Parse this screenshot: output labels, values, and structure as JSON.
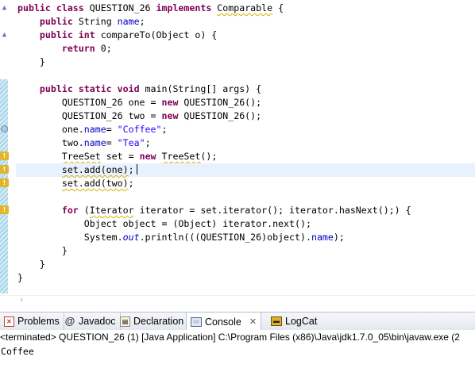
{
  "code_lines": [
    {
      "tokens": [
        {
          "t": "public class ",
          "c": "kw"
        },
        {
          "t": "QUESTION_26 "
        },
        {
          "t": "implements ",
          "c": "kw"
        },
        {
          "t": "Comparable",
          "c": "warnu"
        },
        {
          "t": " {"
        }
      ]
    },
    {
      "tokens": [
        {
          "t": "    "
        },
        {
          "t": "public ",
          "c": "kw"
        },
        {
          "t": "String "
        },
        {
          "t": "name",
          "c": "fld"
        },
        {
          "t": ";"
        }
      ]
    },
    {
      "tokens": [
        {
          "t": "    "
        },
        {
          "t": "public int ",
          "c": "kw"
        },
        {
          "t": "compareTo(Object o) {"
        }
      ]
    },
    {
      "tokens": [
        {
          "t": "        "
        },
        {
          "t": "return ",
          "c": "kw"
        },
        {
          "t": "0;"
        }
      ]
    },
    {
      "tokens": [
        {
          "t": "    }"
        }
      ]
    },
    {
      "tokens": []
    },
    {
      "tokens": [
        {
          "t": "    "
        },
        {
          "t": "public static void ",
          "c": "kw"
        },
        {
          "t": "main(String[] args) {"
        }
      ]
    },
    {
      "tokens": [
        {
          "t": "        QUESTION_26 one = "
        },
        {
          "t": "new ",
          "c": "kw"
        },
        {
          "t": "QUESTION_26();"
        }
      ]
    },
    {
      "tokens": [
        {
          "t": "        QUESTION_26 two = "
        },
        {
          "t": "new ",
          "c": "kw"
        },
        {
          "t": "QUESTION_26();"
        }
      ]
    },
    {
      "tokens": [
        {
          "t": "        one."
        },
        {
          "t": "name",
          "c": "fld"
        },
        {
          "t": "= "
        },
        {
          "t": "\"Coffee\"",
          "c": "str"
        },
        {
          "t": ";"
        }
      ]
    },
    {
      "tokens": [
        {
          "t": "        two."
        },
        {
          "t": "name",
          "c": "fld"
        },
        {
          "t": "= "
        },
        {
          "t": "\"Tea\"",
          "c": "str"
        },
        {
          "t": ";"
        }
      ]
    },
    {
      "tokens": [
        {
          "t": "        "
        },
        {
          "t": "TreeSet",
          "c": "warnu"
        },
        {
          "t": " set = "
        },
        {
          "t": "new ",
          "c": "kw"
        },
        {
          "t": "TreeSet",
          "c": "warnu"
        },
        {
          "t": "();"
        }
      ]
    },
    {
      "tokens": [
        {
          "t": "        "
        },
        {
          "t": "set.add(one)",
          "c": "warnu"
        },
        {
          "t": ";"
        }
      ],
      "current": true
    },
    {
      "tokens": [
        {
          "t": "        "
        },
        {
          "t": "set.add(two)",
          "c": "warnu"
        },
        {
          "t": ";"
        }
      ]
    },
    {
      "tokens": []
    },
    {
      "tokens": [
        {
          "t": "        "
        },
        {
          "t": "for ",
          "c": "kw"
        },
        {
          "t": "("
        },
        {
          "t": "Iterator",
          "c": "warnu"
        },
        {
          "t": " iterator = set.iterator(); iterator.hasNext();) {"
        }
      ]
    },
    {
      "tokens": [
        {
          "t": "            Object object = (Object) iterator.next();"
        }
      ]
    },
    {
      "tokens": [
        {
          "t": "            System."
        },
        {
          "t": "out",
          "c": "st"
        },
        {
          "t": ".println(((QUESTION_26)object)."
        },
        {
          "t": "name",
          "c": "fld"
        },
        {
          "t": ");"
        }
      ]
    },
    {
      "tokens": [
        {
          "t": "        }"
        }
      ]
    },
    {
      "tokens": [
        {
          "t": "    }"
        }
      ]
    },
    {
      "tokens": [
        {
          "t": "}"
        }
      ]
    }
  ],
  "tabs": {
    "problems": "Problems",
    "javadoc": "Javadoc",
    "declaration": "Declaration",
    "console": "Console",
    "console_close": "✕",
    "logcat": "LogCat"
  },
  "icons": {
    "problems": "problems-icon",
    "javadoc": "at-icon",
    "declaration": "declaration-icon",
    "console": "console-icon",
    "logcat": "logcat-icon"
  },
  "console": {
    "status": "<terminated> QUESTION_26 (1) [Java Application] C:\\Program Files (x86)\\Java\\jdk1.7.0_05\\bin\\javaw.exe (2",
    "output": "Coffee"
  },
  "colors": {
    "keyword": "#7f0055",
    "string": "#2a00ff",
    "field": "#0000c0",
    "current_line": "#e8f2fe"
  }
}
